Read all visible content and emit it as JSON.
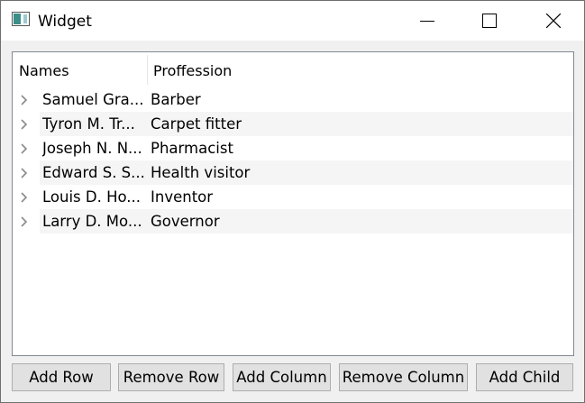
{
  "window": {
    "title": "Widget"
  },
  "tree": {
    "headers": [
      "Names",
      "Proffession"
    ],
    "rows": [
      {
        "name": "Samuel Gra...",
        "profession": "Barber"
      },
      {
        "name": "Tyron M. Tr...",
        "profession": "Carpet fitter"
      },
      {
        "name": "Joseph N. N...",
        "profession": "Pharmacist"
      },
      {
        "name": "Edward S. S...",
        "profession": "Health visitor"
      },
      {
        "name": "Louis D. Ho...",
        "profession": "Inventor"
      },
      {
        "name": "Larry D. Mo...",
        "profession": "Governor"
      }
    ]
  },
  "buttons": {
    "add_row": "Add Row",
    "remove_row": "Remove Row",
    "add_column": "Add Column",
    "remove_column": "Remove Column",
    "add_child": "Add Child"
  },
  "icons": {
    "app": "app-window-icon",
    "minimize": "minimize-icon",
    "maximize": "maximize-icon",
    "close": "close-icon",
    "expand": "chevron-right-icon"
  }
}
